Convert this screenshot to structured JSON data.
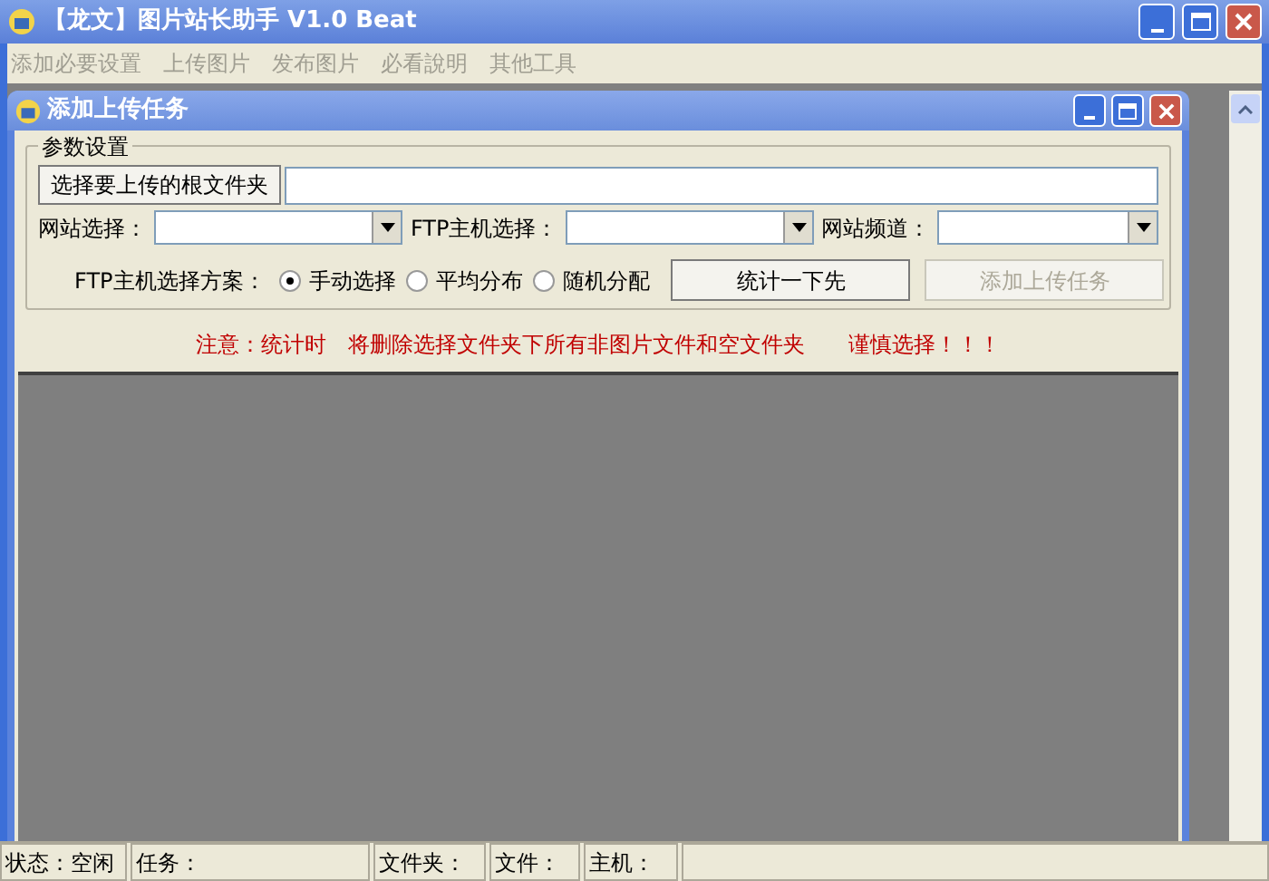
{
  "window": {
    "title": "【龙文】图片站长助手 V1.0 Beat"
  },
  "menu": [
    {
      "label": "添加必要设置",
      "disabled": true
    },
    {
      "label": "上传图片",
      "disabled": true
    },
    {
      "label": "发布图片",
      "disabled": true
    },
    {
      "label": "必看說明",
      "disabled": true
    },
    {
      "label": "其他工具",
      "disabled": true
    }
  ],
  "child_window": {
    "title": "添加上传任务",
    "group": {
      "title": "参数设置",
      "browse_button": "选择要上传的根文件夹",
      "selects": [
        {
          "label": "网站选择："
        },
        {
          "label": "FTP主机选择："
        },
        {
          "label": "网站频道："
        }
      ],
      "scheme_label": "FTP主机选择方案：",
      "scheme_options": [
        {
          "label": "手动选择",
          "selected": true
        },
        {
          "label": "平均分布",
          "selected": false
        },
        {
          "label": "随机分配",
          "selected": false
        }
      ],
      "buttons": [
        {
          "label": "统计一下先",
          "disabled": false
        },
        {
          "label": "添加上传任务",
          "disabled": true
        }
      ]
    },
    "note": "注意：统计时　将删除选择文件夹下所有非图片文件和空文件夹　　谨慎选择！！！"
  },
  "status_bar": [
    "状态：空闲",
    "任务：",
    "文件夹：",
    "文件：",
    "主机："
  ]
}
